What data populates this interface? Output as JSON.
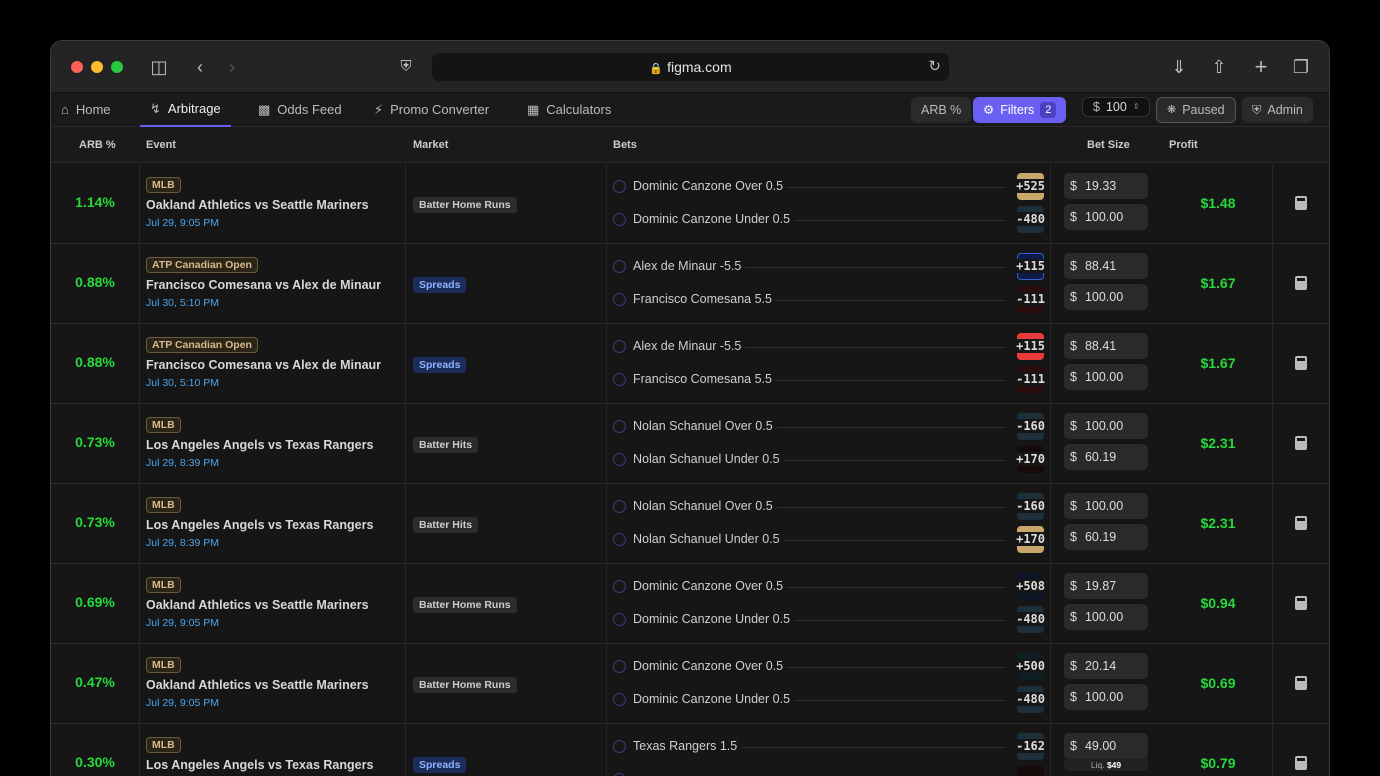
{
  "browser": {
    "url": "figma.com"
  },
  "nav": {
    "tabs": [
      {
        "label": "Home",
        "icon": "home-icon"
      },
      {
        "label": "Arbitrage",
        "icon": "arbitrage-icon",
        "active": true
      },
      {
        "label": "Odds Feed",
        "icon": "bar-chart-icon"
      },
      {
        "label": "Promo Converter",
        "icon": "bolt-icon"
      },
      {
        "label": "Calculators",
        "icon": "calculator-icon"
      }
    ],
    "arb_sort": "ARB %",
    "filters_label": "Filters",
    "filters_count": "2",
    "bet_currency": "$",
    "bet_amount": "100",
    "paused_label": "Paused",
    "admin_label": "Admin"
  },
  "table": {
    "headers": {
      "arb": "ARB %",
      "event": "Event",
      "market": "Market",
      "bets": "Bets",
      "bet_size": "Bet Size",
      "profit": "Profit"
    },
    "rows": [
      {
        "arb": "1.14%",
        "league": "MLB",
        "event": "Oakland Athletics vs Seattle Mariners",
        "date": "Jul 29, 9:05 PM",
        "market": "Batter Home Runs",
        "market_type": "default",
        "bets": [
          {
            "name": "Dominic Canzone  Over 0.5",
            "odds": "+525",
            "book": "mgm",
            "book_glyph": "♕",
            "amount": "19.33"
          },
          {
            "name": "Dominic Canzone  Under 0.5",
            "odds": "-480",
            "book": "cz",
            "book_glyph": "X",
            "amount": "100.00"
          }
        ],
        "profit": "$1.48"
      },
      {
        "arb": "0.88%",
        "league": "ATP Canadian Open",
        "event": "Francisco Comesana vs Alex de Minaur",
        "date": "Jul 30, 5:10 PM",
        "market": "Spreads",
        "market_type": "spreads",
        "bets": [
          {
            "name": "Alex de Minaur -5.5",
            "odds": "+115",
            "book": "lv",
            "book_glyph": "LV",
            "amount": "88.41"
          },
          {
            "name": "Francisco Comesana 5.5",
            "odds": "-111",
            "book": "fb",
            "book_glyph": "ReBet",
            "amount": "100.00"
          }
        ],
        "profit": "$1.67"
      },
      {
        "arb": "0.88%",
        "league": "ATP Canadian Open",
        "event": "Francisco Comesana vs Alex de Minaur",
        "date": "Jul 30, 5:10 PM",
        "market": "Spreads",
        "market_type": "spreads",
        "bets": [
          {
            "name": "Alex de Minaur -5.5",
            "odds": "+115",
            "book": "b",
            "book_glyph": "B",
            "amount": "88.41"
          },
          {
            "name": "Francisco Comesana 5.5",
            "odds": "-111",
            "book": "fb",
            "book_glyph": "ReBet",
            "amount": "100.00"
          }
        ],
        "profit": "$1.67"
      },
      {
        "arb": "0.73%",
        "league": "MLB",
        "event": "Los Angeles Angels vs Texas Rangers",
        "date": "Jul 29, 8:39 PM",
        "market": "Batter Hits",
        "market_type": "default",
        "bets": [
          {
            "name": "Nolan Schanuel  Over 0.5",
            "odds": "-160",
            "book": "cz",
            "book_glyph": "X",
            "amount": "100.00"
          },
          {
            "name": "Nolan Schanuel  Under 0.5",
            "odds": "+170",
            "book": "b8",
            "book_glyph": "B",
            "amount": "60.19"
          }
        ],
        "profit": "$2.31"
      },
      {
        "arb": "0.73%",
        "league": "MLB",
        "event": "Los Angeles Angels vs Texas Rangers",
        "date": "Jul 29, 8:39 PM",
        "market": "Batter Hits",
        "market_type": "default",
        "bets": [
          {
            "name": "Nolan Schanuel  Over 0.5",
            "odds": "-160",
            "book": "cz",
            "book_glyph": "X",
            "amount": "100.00"
          },
          {
            "name": "Nolan Schanuel  Under 0.5",
            "odds": "+170",
            "book": "mgm",
            "book_glyph": "♕",
            "amount": "60.19"
          }
        ],
        "profit": "$2.31"
      },
      {
        "arb": "0.69%",
        "league": "MLB",
        "event": "Oakland Athletics vs Seattle Mariners",
        "date": "Jul 29, 9:05 PM",
        "market": "Batter Home Runs",
        "market_type": "default",
        "bets": [
          {
            "name": "Dominic Canzone  Over 0.5",
            "odds": "+508",
            "book": "p",
            "book_glyph": "P",
            "amount": "19.87"
          },
          {
            "name": "Dominic Canzone  Under 0.5",
            "odds": "-480",
            "book": "cz",
            "book_glyph": "X",
            "amount": "100.00"
          }
        ],
        "profit": "$0.94"
      },
      {
        "arb": "0.47%",
        "league": "MLB",
        "event": "Oakland Athletics vs Seattle Mariners",
        "date": "Jul 29, 9:05 PM",
        "market": "Batter Home Runs",
        "market_type": "default",
        "bets": [
          {
            "name": "Dominic Canzone  Over 0.5",
            "odds": "+500",
            "book": "e",
            "book_glyph": "E",
            "amount": "20.14"
          },
          {
            "name": "Dominic Canzone  Under 0.5",
            "odds": "-480",
            "book": "cz",
            "book_glyph": "X",
            "amount": "100.00"
          }
        ],
        "profit": "$0.69"
      },
      {
        "arb": "0.30%",
        "league": "MLB",
        "event": "Los Angeles Angels vs Texas Rangers",
        "date": "",
        "market": "Spreads",
        "market_type": "spreads",
        "bets": [
          {
            "name": "Texas Rangers 1.5",
            "odds": "-162",
            "book": "cz",
            "book_glyph": "X",
            "amount": "49.00",
            "liq_label": "Liq.",
            "liq_value": "$49"
          },
          {
            "name": "",
            "odds": "",
            "book": "b8",
            "book_glyph": "",
            "amount": ""
          }
        ],
        "profit": "$0.79"
      }
    ]
  }
}
